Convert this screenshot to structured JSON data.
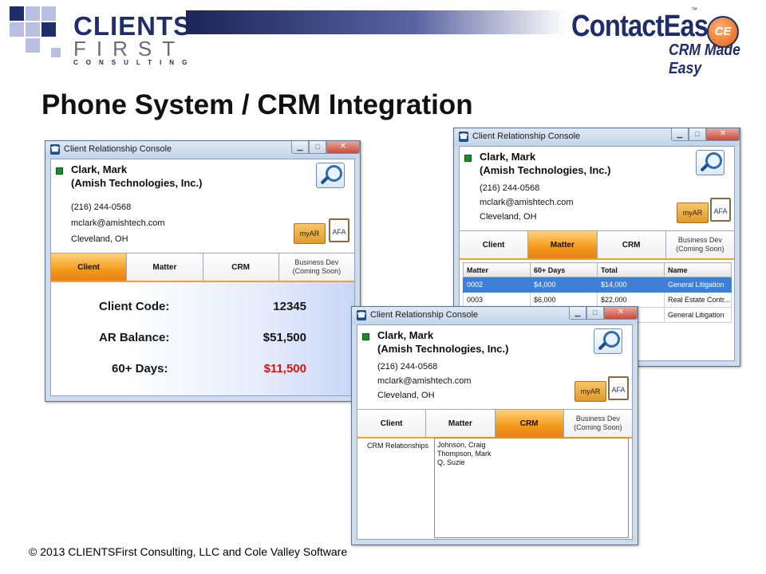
{
  "slide": {
    "title": "Phone System / CRM Integration",
    "footer": "© 2013 CLIENTSFirst Consulting, LLC and Cole Valley Software"
  },
  "logos": {
    "clientsfirst": {
      "line1": "CLIENTS",
      "line2": "FIRST",
      "line3": "CONSULTING"
    },
    "contactease": {
      "name": "ContactEase",
      "tm": "™",
      "badge": "CE",
      "tagline": "CRM Made Easy"
    }
  },
  "colors": {
    "brand_navy": "#1f2d6b",
    "tab_active": "#f39a1a",
    "selected_row": "#3f7fd6",
    "past_due_red": "#e01010",
    "status_green": "#1c8a2e"
  },
  "window_common": {
    "title": "Client Relationship Console",
    "min_icon": "minimize-icon",
    "max_icon": "maximize-icon",
    "close_icon": "close-icon",
    "min_glyph": "▁",
    "max_glyph": "□",
    "close_glyph": "✕"
  },
  "contact": {
    "name": "Clark, Mark",
    "company": "(Amish Technologies, Inc.)",
    "phone": "(216) 244-0568",
    "email": "mclark@amishtech.com",
    "location": "Cleveland, OH",
    "myar_label": "myAR",
    "afa_label": "AFA"
  },
  "tabs": [
    {
      "label": "Client"
    },
    {
      "label": "Matter"
    },
    {
      "label": "CRM"
    },
    {
      "label": "Business Dev",
      "sublabel": "(Coming Soon)"
    }
  ],
  "window_client": {
    "active_tab": "Client",
    "client_code_label": "Client Code:",
    "client_code": "12345",
    "ar_balance_label": "AR Balance:",
    "ar_balance": "$51,500",
    "days60_label": "60+ Days:",
    "days60": "$11,500"
  },
  "window_matter": {
    "active_tab": "Matter",
    "columns": [
      "Matter",
      "60+ Days",
      "Total",
      "Name"
    ],
    "rows": [
      {
        "matter": "0002",
        "days60": "$4,000",
        "total": "$14,000",
        "name": "General Litigation",
        "selected": true
      },
      {
        "matter": "0003",
        "days60": "$6,000",
        "total": "$22,000",
        "name": "Real Estate Contr...",
        "selected": false
      },
      {
        "matter": "",
        "days60": "",
        "total": "",
        "name": "General Litigation",
        "selected": false
      }
    ]
  },
  "window_crm": {
    "active_tab": "CRM",
    "relationships_label": "CRM Relationships",
    "relationships": [
      "Johnson, Craig",
      "Thompson, Mark",
      "Q, Suzie"
    ]
  }
}
